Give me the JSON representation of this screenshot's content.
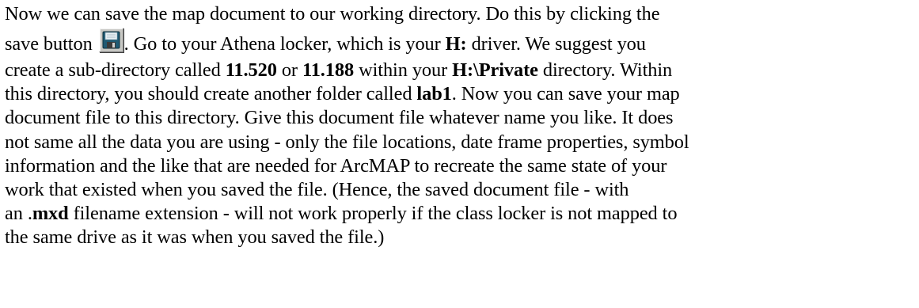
{
  "paragraph": {
    "l1": "Now we can save the map document to our working directory. Do this by clicking the",
    "l2_a": "save button",
    "l2_b": ". Go to your Athena locker, which is your ",
    "l2_bold": "H:",
    "l2_c": " driver. We suggest you",
    "l3_a": "create a sub-directory called ",
    "l3_bold1": "11.520",
    "l3_b": " or ",
    "l3_bold2": "11.188",
    "l3_c": " within your ",
    "l3_bold3": "H:\\Private",
    "l3_d": " directory. Within",
    "l4_a": "this directory, you should create another folder called ",
    "l4_bold": "lab1",
    "l4_b": ". Now you can save your map",
    "l5": "document file to this directory. Give this document file whatever name you like. It does",
    "l6": "not same all the data you are using - only the file locations, date frame properties, symbol",
    "l7": "information and the like that are needed for ArcMAP to recreate the same state of your",
    "l8": "work that existed when you saved the file. (Hence, the saved document file - with",
    "l9_a": "an .",
    "l9_bold": "mxd",
    "l9_b": " filename extension - will not work properly if the class locker is not mapped to",
    "l10": "the same drive as it was when you saved the file.)"
  },
  "icons": {
    "save": "floppy-disk-icon"
  },
  "colors": {
    "text": "#000000",
    "background": "#ffffff",
    "button_face": "#c8c8c4",
    "floppy_body": "#1f5a73",
    "floppy_label": "#e8f0f4"
  }
}
